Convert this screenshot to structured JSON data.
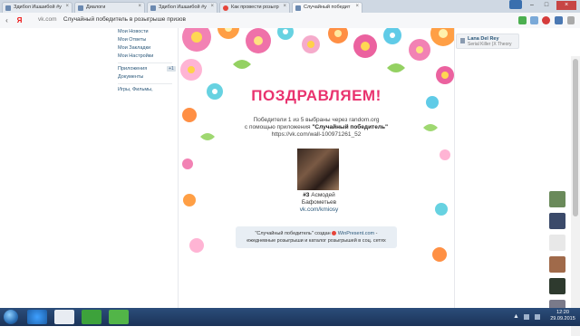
{
  "browser": {
    "tabs": [
      {
        "label": "Здибол Ишшибой #у",
        "icon_color": "#6b89b0"
      },
      {
        "label": "Диалоги",
        "icon_color": "#6b89b0"
      },
      {
        "label": "Здибол Ишшибой #у",
        "icon_color": "#6b89b0"
      },
      {
        "label": "Как провести розыгр",
        "icon_color": "#e5443a"
      },
      {
        "label": "Случайный победит",
        "icon_color": "#6b89b0"
      }
    ],
    "tab_close": "×",
    "window_controls": {
      "minimize": "–",
      "maximize": "□",
      "close": "×"
    },
    "nav": {
      "back": "‹",
      "yandex": "Я"
    },
    "url_domain": "vk.com",
    "url_title": "Случайный победитель в розыгрыше призов",
    "accent": "#5b7fb0"
  },
  "sidebar": {
    "items": [
      {
        "label": "Мои Новости"
      },
      {
        "label": "Мои Ответы"
      },
      {
        "label": "Мои Закладки"
      },
      {
        "label": "Мои Настройки"
      }
    ],
    "apps_label": "Приложения",
    "apps_badge": "+1",
    "docs_label": "Документы",
    "games_label": "Игры, Фильмы,"
  },
  "post": {
    "heading": "ПОЗДРАВЛЯЕМ!",
    "line1": "Победители 1 из 5 выбраны через random.org",
    "line2_prefix": "с помощью приложения",
    "app_name": "\"Случайный победитель\"",
    "wall_link": "https://vk.com/wall-100971261_52",
    "winner_number": "#3",
    "winner_first": "Асмодей",
    "winner_last": "Бафометьев",
    "winner_link": "vk.com/kmiosy",
    "footnote_line1a": "\"Случайный победитель\" создан",
    "footnote_brand": "WinPresent.com",
    "footnote_line1b": "-",
    "footnote_line2": "ежедневные розыгрыши и каталог розыгрышей в соц. сетях"
  },
  "player": {
    "artist": "Lana Del Rey",
    "track": "Serial Killer (X Theory"
  },
  "taskbar": {
    "time": "12:20",
    "date": "29.09.2015",
    "tray_arrow": "▲",
    "colors": {
      "bg": "#1b3358"
    }
  }
}
